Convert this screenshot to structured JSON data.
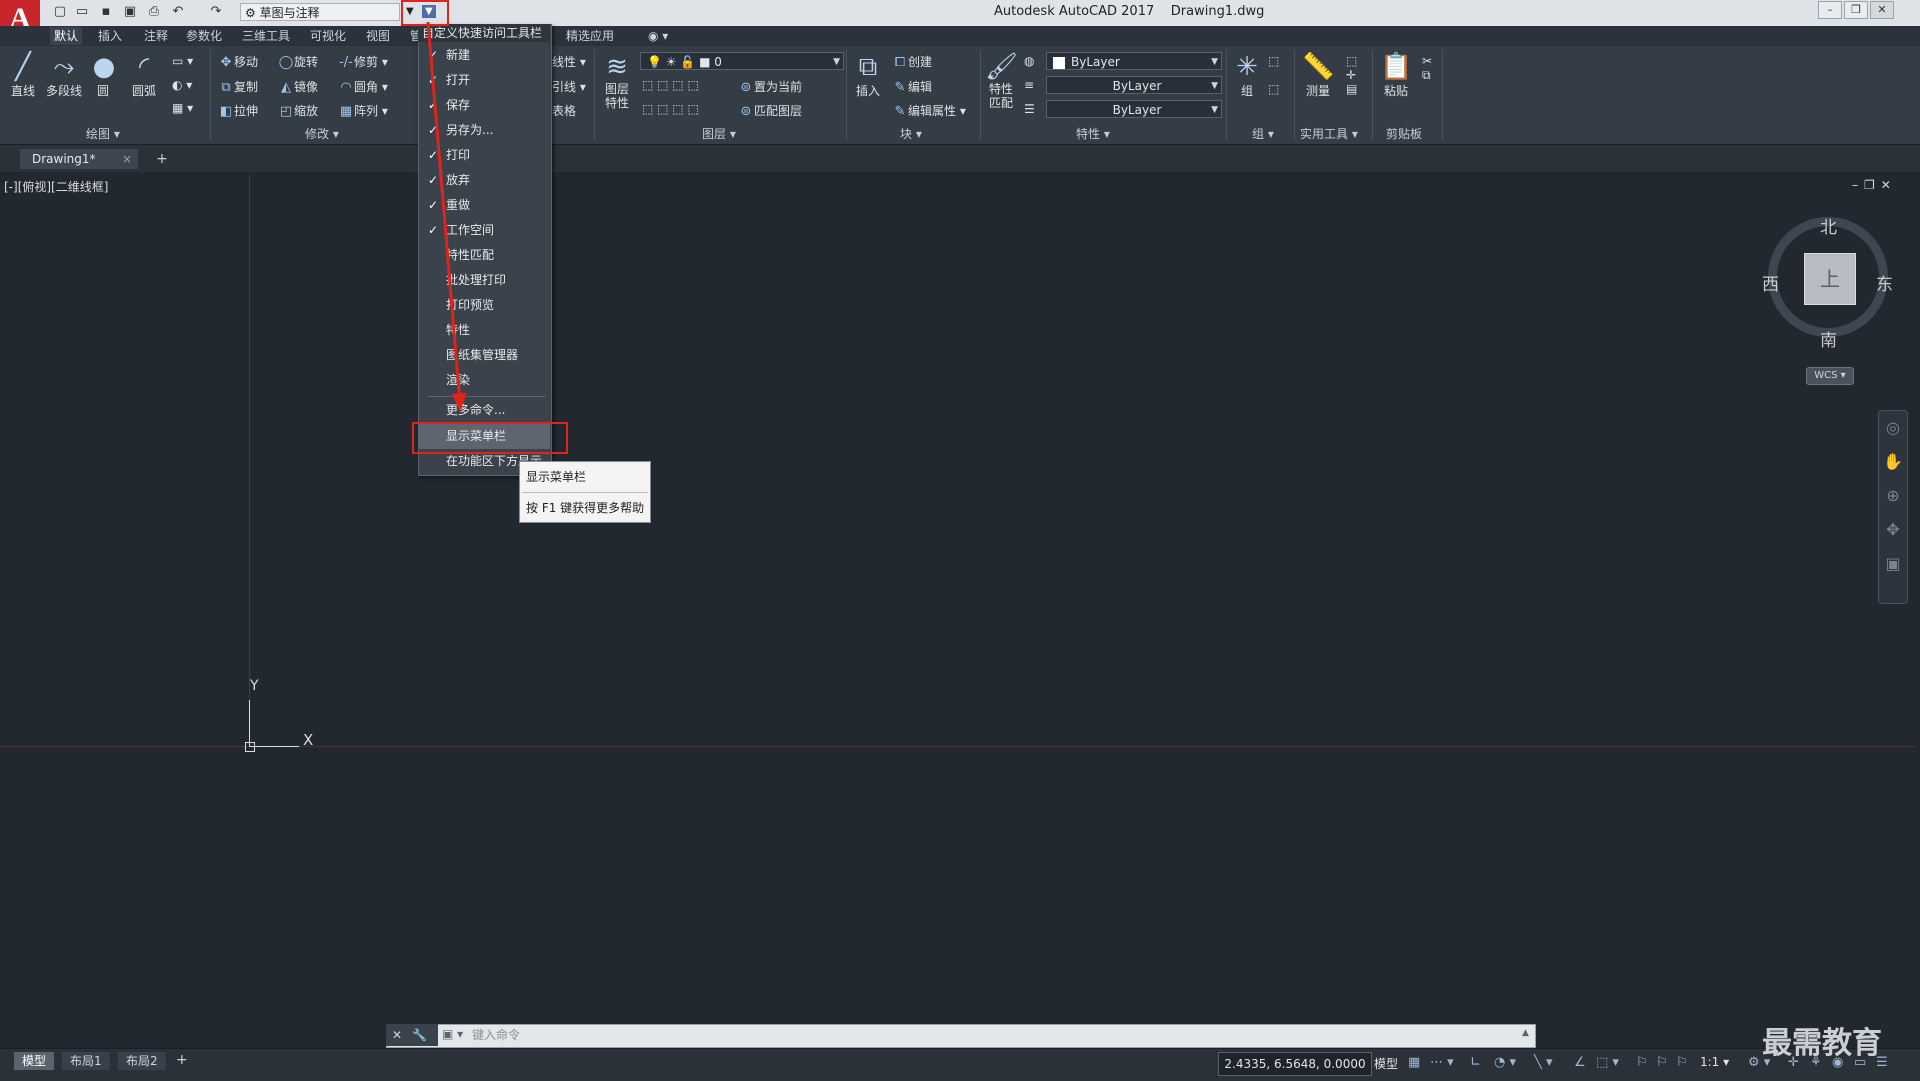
{
  "title": {
    "app_name": "Autodesk AutoCAD 2017",
    "filename": "Drawing1.dwg",
    "logo_letter": "A",
    "workspace": "草图与注释"
  },
  "ribbon_tabs": [
    "默认",
    "插入",
    "注释",
    "参数化",
    "三维工具",
    "可视化",
    "视图",
    "管",
    "精选应用"
  ],
  "ribbon": {
    "draw": {
      "items": [
        "直线",
        "多段线",
        "圆",
        "圆弧"
      ],
      "title": "绘图"
    },
    "modify": {
      "items": [
        "移动",
        "旋转",
        "修剪",
        "复制",
        "镜像",
        "圆角",
        "拉伸",
        "缩放",
        "阵列"
      ],
      "title": "修改"
    },
    "annotation_partial": [
      "线性",
      "引线",
      "表格"
    ],
    "layers": {
      "layer_props": "图层特性",
      "current_layer": "0",
      "set_current": "置为当前",
      "match_layer": "匹配图层",
      "title": "图层"
    },
    "block": {
      "insert": "插入",
      "create": "创建",
      "edit": "编辑",
      "edit_attr": "编辑属性",
      "title": "块"
    },
    "properties": {
      "match": "特性匹配",
      "color": "ByLayer",
      "linetype": "ByLayer",
      "lineweight": "ByLayer",
      "title": "特性"
    },
    "groups": {
      "group": "组",
      "title": "组"
    },
    "utilities": {
      "measure": "测量",
      "title": "实用工具"
    },
    "clipboard": {
      "paste": "粘贴",
      "title": "剪贴板"
    }
  },
  "doc_tab": "Drawing1*",
  "viewport_label": "[-][俯视][二维线框]",
  "navcube": {
    "north": "北",
    "south": "南",
    "east": "东",
    "west": "西",
    "face": "上",
    "wcs": "WCS"
  },
  "ucs": {
    "x": "X",
    "y": "Y"
  },
  "qat_menu": {
    "header": "自定义快速访问工具栏",
    "items": [
      {
        "label": "新建",
        "checked": "✓"
      },
      {
        "label": "打开",
        "checked": "✓"
      },
      {
        "label": "保存",
        "checked": "✓"
      },
      {
        "label": "另存为...",
        "checked": "✓"
      },
      {
        "label": "打印",
        "checked": "✓"
      },
      {
        "label": "放弃",
        "checked": "✓"
      },
      {
        "label": "重做",
        "checked": "✓"
      },
      {
        "label": "工作空间",
        "checked": "✓"
      },
      {
        "label": "特性匹配",
        "checked": ""
      },
      {
        "label": "批处理打印",
        "checked": ""
      },
      {
        "label": "打印预览",
        "checked": ""
      },
      {
        "label": "特性",
        "checked": ""
      },
      {
        "label": "图纸集管理器",
        "checked": ""
      },
      {
        "label": "渲染",
        "checked": ""
      }
    ],
    "more": "更多命令...",
    "show_menubar": "显示菜单栏",
    "below_ribbon": "在功能区下方显示"
  },
  "tooltip": {
    "title": "显示菜单栏",
    "help": "按 F1 键获得更多帮助"
  },
  "command_line": {
    "placeholder": "键入命令"
  },
  "layout_tabs": [
    "模型",
    "布局1",
    "布局2"
  ],
  "status": {
    "coords": "2.4335, 6.5648, 0.0000",
    "model": "模型",
    "scale": "1:1"
  },
  "watermark": "最需教育",
  "colors": {
    "highlight": "#e0231b",
    "logo": "#c8262b"
  }
}
